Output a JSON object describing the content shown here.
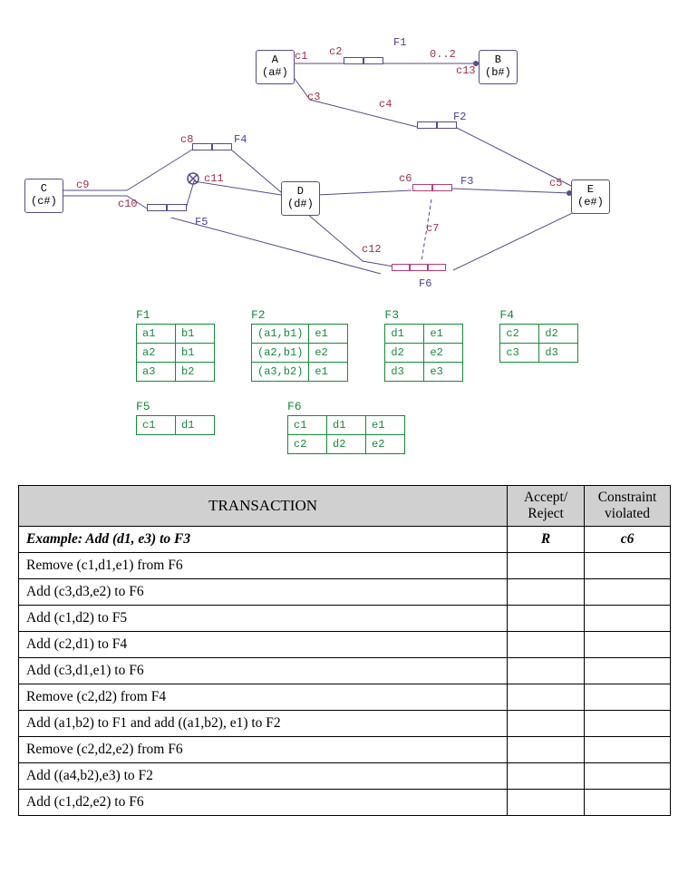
{
  "diagram": {
    "nodes": {
      "A": {
        "name": "A",
        "id": "(a#)"
      },
      "B": {
        "name": "B",
        "id": "(b#)"
      },
      "C": {
        "name": "C",
        "id": "(c#)"
      },
      "D": {
        "name": "D",
        "id": "(d#)"
      },
      "E": {
        "name": "E",
        "id": "(e#)"
      }
    },
    "f_labels": {
      "F1": "F1",
      "F2": "F2",
      "F3": "F3",
      "F4": "F4",
      "F5": "F5",
      "F6": "F6"
    },
    "c_labels": {
      "c1": "c1",
      "c2": "c2",
      "c3": "c3",
      "c4": "c4",
      "c5": "c5",
      "c6": "c6",
      "c7": "c7",
      "c8": "c8",
      "c9": "c9",
      "c10": "c10",
      "c11": "c11",
      "c12": "c12",
      "c13": "c13"
    },
    "multiplicity": "0..2"
  },
  "ftables": {
    "F1": {
      "name": "F1",
      "rows": [
        [
          "a1",
          "b1"
        ],
        [
          "a2",
          "b1"
        ],
        [
          "a3",
          "b2"
        ]
      ]
    },
    "F2": {
      "name": "F2",
      "rows": [
        [
          "(a1,b1)",
          "e1"
        ],
        [
          "(a2,b1)",
          "e2"
        ],
        [
          "(a3,b2)",
          "e1"
        ]
      ]
    },
    "F3": {
      "name": "F3",
      "rows": [
        [
          "d1",
          "e1"
        ],
        [
          "d2",
          "e2"
        ],
        [
          "d3",
          "e3"
        ]
      ]
    },
    "F4": {
      "name": "F4",
      "rows": [
        [
          "c2",
          "d2"
        ],
        [
          "c3",
          "d3"
        ]
      ]
    },
    "F5": {
      "name": "F5",
      "rows": [
        [
          "c1",
          "d1"
        ]
      ]
    },
    "F6": {
      "name": "F6",
      "rows": [
        [
          "c1",
          "d1",
          "e1"
        ],
        [
          "c2",
          "d2",
          "e2"
        ]
      ]
    }
  },
  "transaction_table": {
    "headers": {
      "tx": "TRANSACTION",
      "ar": "Accept/ Reject",
      "cv": "Constraint violated"
    },
    "rows": [
      {
        "tx": "Example: Add (d1, e3) to F3",
        "ar": "R",
        "cv": "c6",
        "example": true
      },
      {
        "tx": "Remove (c1,d1,e1) from F6",
        "ar": "",
        "cv": ""
      },
      {
        "tx": "Add (c3,d3,e2) to F6",
        "ar": "",
        "cv": ""
      },
      {
        "tx": "Add (c1,d2) to F5",
        "ar": "",
        "cv": ""
      },
      {
        "tx": "Add (c2,d1) to F4",
        "ar": "",
        "cv": ""
      },
      {
        "tx": "Add (c3,d1,e1) to F6",
        "ar": "",
        "cv": ""
      },
      {
        "tx": "Remove (c2,d2) from F4",
        "ar": "",
        "cv": ""
      },
      {
        "tx": "Add (a1,b2) to F1 and add ((a1,b2), e1) to F2",
        "ar": "",
        "cv": ""
      },
      {
        "tx": "Remove (c2,d2,e2) from F6",
        "ar": "",
        "cv": ""
      },
      {
        "tx": "Add ((a4,b2),e3) to F2",
        "ar": "",
        "cv": ""
      },
      {
        "tx": "Add (c1,d2,e2) to F6",
        "ar": "",
        "cv": ""
      }
    ]
  }
}
